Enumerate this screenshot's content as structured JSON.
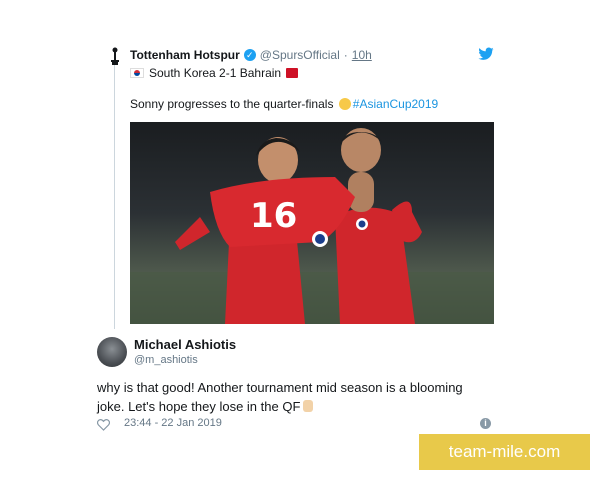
{
  "embedded_tweet": {
    "author_name": "Tottenham Hotspur",
    "verified_symbol": "✓",
    "handle": "@SpursOfficial",
    "separator": "·",
    "age": "10h",
    "match_line": "South Korea 2-1 Bahrain",
    "text_before": "Sonny progresses to the quarter-finals",
    "hashtag": "#AsianCup2019",
    "photo_jersey_number": "16"
  },
  "reply_tweet": {
    "author_name": "Michael Ashiotis",
    "handle": "@m_ashiotis",
    "text": "why is that good! Another tournament mid season is a blooming joke. Let's hope they lose in the QF",
    "timestamp": "23:44 - 22 Jan 2019",
    "info_symbol": "i"
  },
  "watermark": "team-mile.com",
  "icons": [
    "spurs-logo-icon",
    "verified-icon",
    "twitter-bird-icon",
    "south-korea-flag-icon",
    "bahrain-flag-icon",
    "clapping-hands-icon",
    "middle-finger-icon",
    "heart-icon",
    "info-icon"
  ],
  "colors": {
    "twitter_blue": "#1da1f2",
    "hashtag": "#1b95e0",
    "muted": "#657786",
    "jersey_red": "#d0262c",
    "watermark_bg": "#e8c94a"
  }
}
